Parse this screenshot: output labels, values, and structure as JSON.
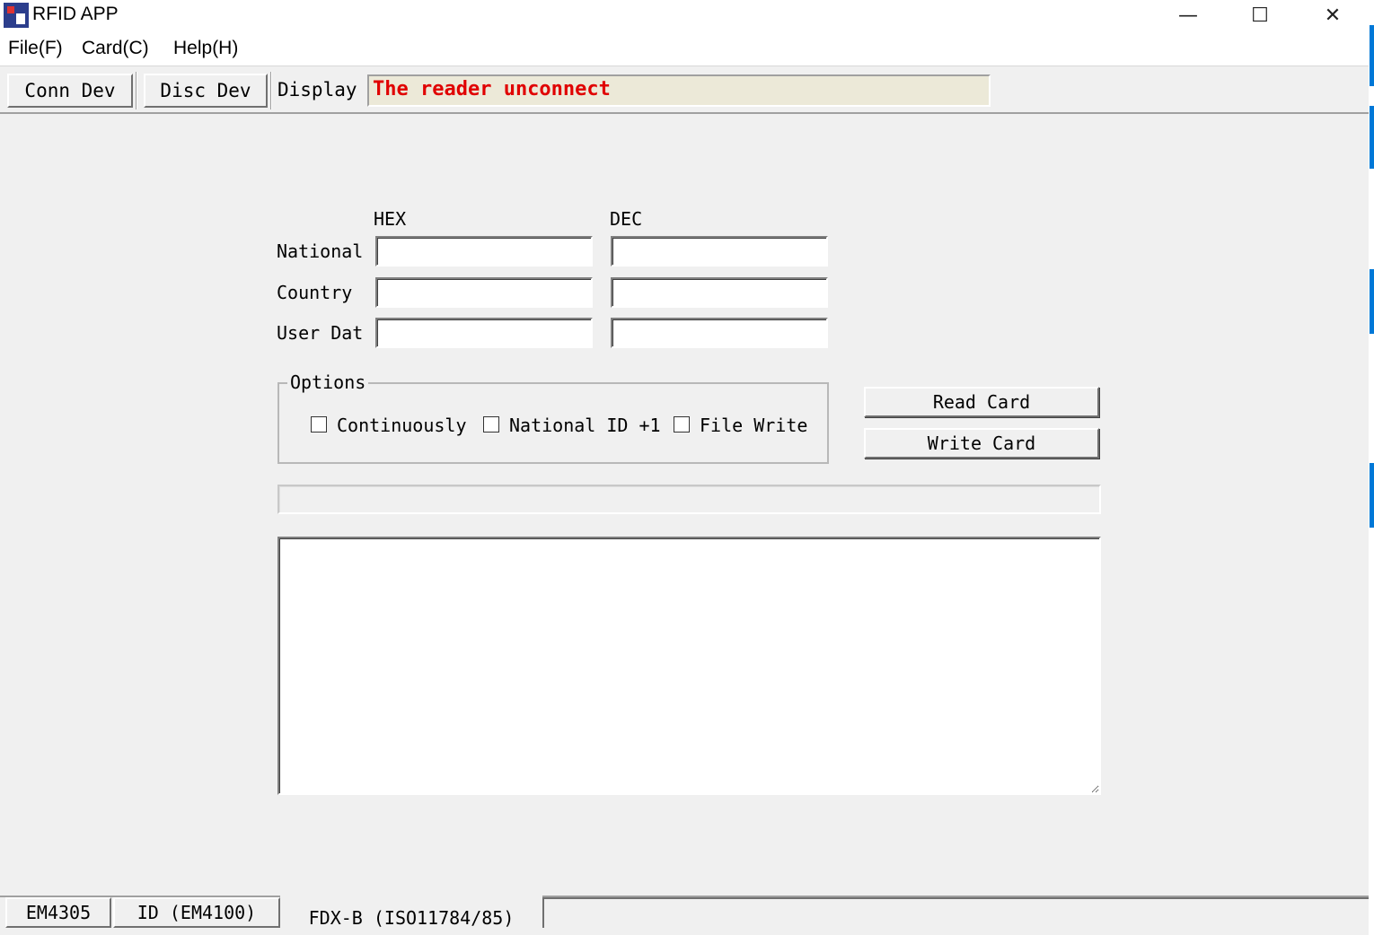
{
  "window": {
    "title": "RFID APP",
    "minimize": "—",
    "maximize": "☐",
    "close": "✕"
  },
  "menu": [
    "File(F)",
    "Card(C)",
    "Help(H)"
  ],
  "toolbar": {
    "conn_label": "Conn Dev",
    "disc_label": "Disc Dev",
    "display_label": "Display",
    "display_value": "The reader unconnect",
    "display_color": "#e00000"
  },
  "form": {
    "col_hex": "HEX",
    "col_dec": "DEC",
    "rows": [
      {
        "label": "National",
        "hex": "",
        "dec": ""
      },
      {
        "label": "Country",
        "hex": "",
        "dec": ""
      },
      {
        "label": "User Dat",
        "hex": "",
        "dec": ""
      }
    ]
  },
  "options": {
    "legend": "Options",
    "items": [
      {
        "label": "Continuously",
        "checked": false
      },
      {
        "label": "National ID +1",
        "checked": false
      },
      {
        "label": "File Write",
        "checked": false
      }
    ]
  },
  "actions": {
    "read_label": "Read Card",
    "write_label": "Write Card"
  },
  "log": "",
  "tabs": {
    "items": [
      "EM4305",
      "ID (EM4100)"
    ],
    "active": "FDX-B (ISO11784/85)"
  }
}
